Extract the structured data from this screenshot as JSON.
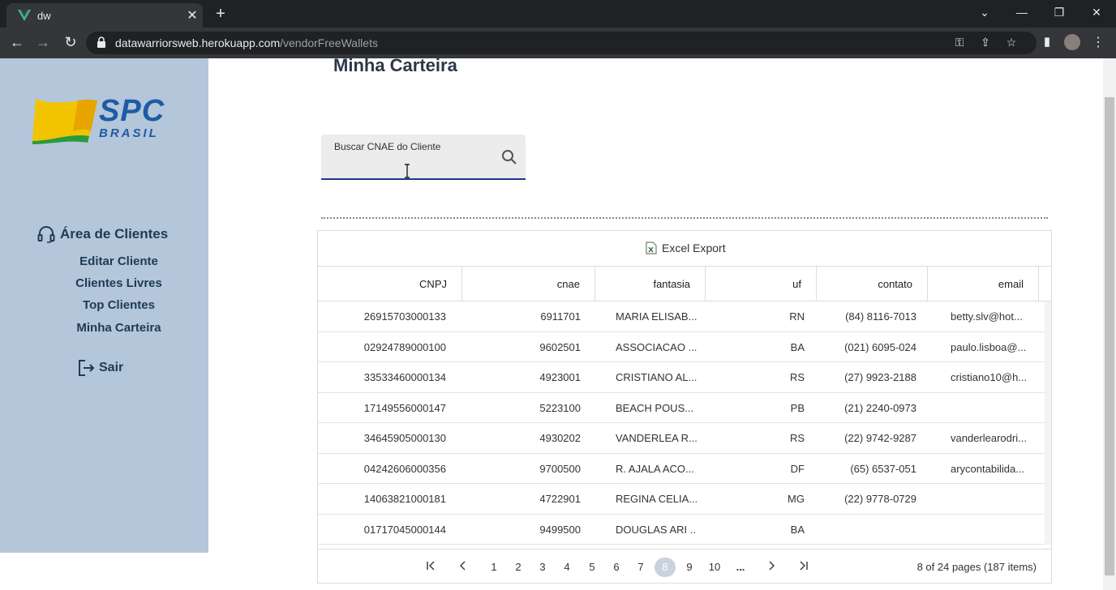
{
  "browser": {
    "tab_title": "dw",
    "tab_close": "✕",
    "new_tab": "+",
    "url_host": "datawarriorsweb.herokuapp.com",
    "url_path": "/vendorFreeWallets"
  },
  "sidebar": {
    "logo_text": "SPC",
    "logo_sub": "BRASIL",
    "area_title": "Área de Clientes",
    "links": [
      "Editar Cliente",
      "Clientes Livres",
      "Top Clientes",
      "Minha Carteira"
    ],
    "logout": "Sair"
  },
  "main": {
    "title": "Minha Carteira",
    "search": {
      "label": "Buscar CNAE do Cliente"
    },
    "export_label": "Excel Export",
    "columns": [
      "CNPJ",
      "cnae",
      "fantasia",
      "uf",
      "contato",
      "email"
    ],
    "rows": [
      [
        "26915703000133",
        "6911701",
        "MARIA ELISAB...",
        "RN",
        "(84) 8116-7013",
        "betty.slv@hot..."
      ],
      [
        "02924789000100",
        "9602501",
        "ASSOCIACAO ...",
        "BA",
        "(021) 6095-024",
        "paulo.lisboa@..."
      ],
      [
        "33533460000134",
        "4923001",
        "CRISTIANO AL...",
        "RS",
        "(27) 9923-2188",
        "cristiano10@h..."
      ],
      [
        "17149556000147",
        "5223100",
        "BEACH POUS...",
        "PB",
        "(21) 2240-0973",
        ""
      ],
      [
        "34645905000130",
        "4930202",
        "VANDERLEA R...",
        "RS",
        "(22) 9742-9287",
        "vanderlearodri..."
      ],
      [
        "04242606000356",
        "9700500",
        "R. AJALA ACO...",
        "DF",
        "(65) 6537-051",
        "arycontabilida..."
      ],
      [
        "14063821000181",
        "4722901",
        "REGINA CELIA...",
        "MG",
        "(22) 9778-0729",
        ""
      ],
      [
        "01717045000144",
        "9499500",
        "DOUGLAS ARI ...",
        "BA",
        "",
        ""
      ]
    ],
    "pager": {
      "first": "|<",
      "prev": "<",
      "pages": [
        "1",
        "2",
        "3",
        "4",
        "5",
        "6",
        "7",
        "8",
        "9",
        "10",
        "..."
      ],
      "current_page": "8",
      "next": ">",
      "last": ">|",
      "info": "8 of 24 pages (187 items)"
    }
  },
  "colors": {
    "sidebar_bg": "#b3c6da",
    "brand_blue": "#1f5aa6",
    "search_underline": "#1a3a8a"
  }
}
